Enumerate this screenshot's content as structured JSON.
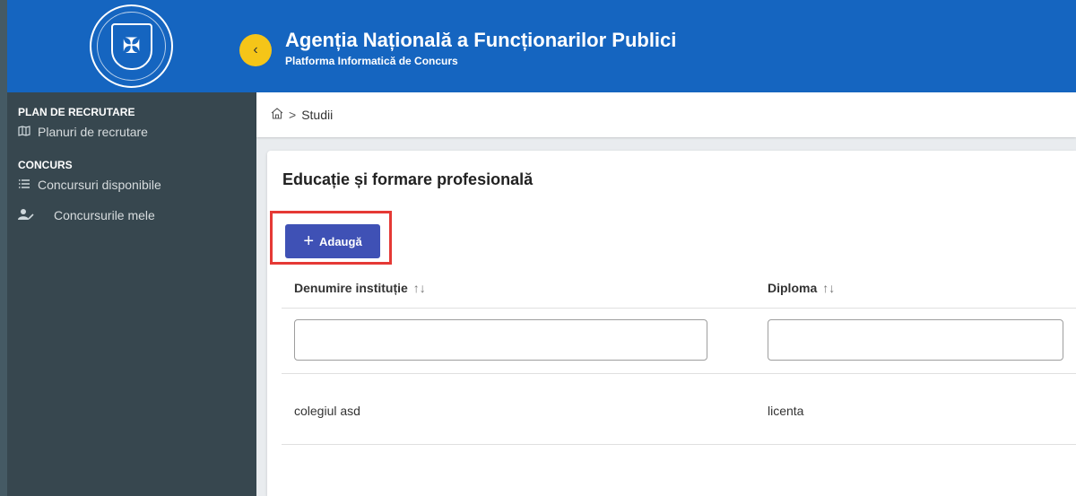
{
  "sidebar": {
    "logo_icon": "coat-of-arms-icon",
    "sections": [
      {
        "title": "PLAN DE RECRUTARE",
        "items": [
          {
            "label": "Planuri de recrutare",
            "icon": "map-icon"
          }
        ]
      },
      {
        "title": "CONCURS",
        "items": [
          {
            "label": "Concursuri disponibile",
            "icon": "list-icon"
          },
          {
            "label": "Concursurile mele",
            "icon": "user-edit-icon"
          }
        ]
      }
    ]
  },
  "header": {
    "title": "Agenția Națională a Funcționarilor Publici",
    "subtitle": "Platforma Informatică de Concurs"
  },
  "breadcrumb": {
    "current": "Studii"
  },
  "card": {
    "title": "Educație și formare profesională",
    "add_label": "Adaugă"
  },
  "table": {
    "columns": [
      "Denumire instituție",
      "Diploma"
    ],
    "filters": [
      "",
      ""
    ],
    "rows": [
      [
        "colegiul asd",
        "licenta"
      ]
    ]
  },
  "colors": {
    "header": "#1565c0",
    "sidebar": "#37474f",
    "accent_button": "#3f51b5",
    "collapse_button": "#f5c518",
    "highlight_box": "#e53935"
  }
}
